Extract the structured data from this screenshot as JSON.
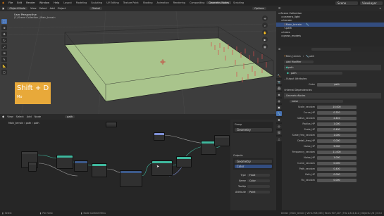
{
  "topbar": {
    "menus": [
      "File",
      "Edit",
      "Render",
      "Window",
      "Help"
    ],
    "workspaces": [
      "Layout",
      "Modeling",
      "Sculpting",
      "UV Editing",
      "Texture Paint",
      "Shading",
      "Animation",
      "Rendering",
      "Compositing",
      "Geometry Nodes",
      "Scripting"
    ],
    "active_workspace": "Geometry Nodes",
    "scene_name": "Scene",
    "view_layer": "ViewLayer"
  },
  "viewport": {
    "mode": "Object Mode",
    "menus": [
      "View",
      "Select",
      "Add",
      "Object"
    ],
    "transform_orientation": "Global",
    "options_label": "Options",
    "overlay_title": "User Perspective",
    "overlay_sub": "(1) Scene Collection | Main_terrain"
  },
  "outliner": {
    "items": [
      {
        "label": "Scene Collection",
        "selected": false
      },
      {
        "label": "camera_light",
        "selected": false
      },
      {
        "label": "terrain",
        "selected": false
      },
      {
        "label": "Main_terrain",
        "selected": true
      },
      {
        "label": "path",
        "selected": false
      },
      {
        "label": "trees",
        "selected": false
      },
      {
        "label": "grass_models",
        "selected": false
      }
    ]
  },
  "properties": {
    "object_name": "Main_terrain",
    "modifier_name": "path",
    "add_modifier": "Add Modifier",
    "geo_node": "path",
    "output_attributes": "Output Attributes",
    "color_label": "Color",
    "color_value": "path",
    "internal_dependencies": "Internal Dependencies",
    "geometry_nodes_label": "GeometryNodes",
    "noise_label": "noise",
    "rows": [
      {
        "label": "Scale_random",
        "value": "10.000"
      },
      {
        "label": "Curve_HP",
        "value": "0.320"
      },
      {
        "label": "radius_random",
        "value": "2.410"
      },
      {
        "label": "Radius_HP",
        "value": "1.000"
      },
      {
        "label": "Scale_HP",
        "value": "0.400"
      },
      {
        "label": "Scale_freq_random",
        "value": "1.000"
      },
      {
        "label": "Detail_freq_HP",
        "value": "0.000"
      },
      {
        "label": "Noise_HP",
        "value": "2.000"
      },
      {
        "label": "Frequency_random",
        "value": "11.000"
      },
      {
        "label": "Noise_HP",
        "value": "1.000"
      },
      {
        "label": "Curve_random",
        "value": "0.000"
      },
      {
        "label": "Path_random",
        "value": "0.400"
      },
      {
        "label": "Path_HP",
        "value": "0.000"
      },
      {
        "label": "Fix_random",
        "value": "0.000"
      }
    ]
  },
  "node_editor": {
    "menus": [
      "View",
      "Select",
      "Add",
      "Node"
    ],
    "breadcrumb": [
      "Main_terrain",
      "path",
      "path"
    ],
    "header_object": "path",
    "group_input_label": "Group",
    "panel_geometry": "Geometry",
    "panel_outputs": "Outputs",
    "panel_color": "Color",
    "type_label": "Type",
    "type_value": "Float",
    "name_label": "Name",
    "name_value": "Color",
    "tooltip_label": "Tooltip",
    "attribute_label": "Attribute",
    "attribute_value": "Point"
  },
  "overlay_hint": {
    "keys": "Shift + D",
    "sub": "Mo"
  },
  "statusbar": {
    "left": "Select",
    "middle1": "Pan View",
    "middle2": "Node Context Menu",
    "right": "terrain | Main_terrain | Verts 908,363 | Faces 907,207 | Tris 1,814,412 | Objects 1/8 | 3.3.0"
  },
  "colors": {
    "accent": "#4772b3",
    "plane": "#a9c48c",
    "overlay_hint": "#e8a93a",
    "scatter": "#d84a4a"
  }
}
